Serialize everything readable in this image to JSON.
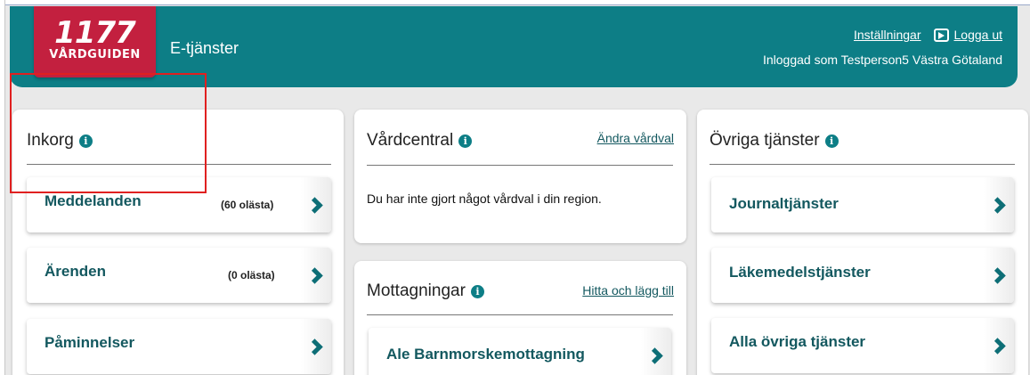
{
  "header": {
    "logo_number": "1177",
    "logo_text": "VÅRDGUIDEN",
    "app_title": "E-tjänster",
    "settings_link": "Inställningar",
    "logout_link": "Logga ut",
    "logged_in_text": "Inloggad som Testperson5 Västra Götaland"
  },
  "inbox": {
    "title": "Inkorg",
    "items": [
      {
        "label": "Meddelanden",
        "count": "(60 olästa)"
      },
      {
        "label": "Ärenden",
        "count": "(0 olästa)"
      },
      {
        "label": "Påminnelser",
        "count": ""
      }
    ]
  },
  "health_center": {
    "title": "Vårdcentral",
    "link": "Ändra vårdval",
    "message": "Du har inte gjort något vårdval i din region."
  },
  "clinics": {
    "title": "Mottagningar",
    "link": "Hitta och lägg till",
    "items": [
      {
        "label": "Ale Barnmorskemottagning"
      }
    ]
  },
  "other_services": {
    "title": "Övriga tjänster",
    "items": [
      {
        "label": "Journaltjänster"
      },
      {
        "label": "Läkemedelstjänster"
      },
      {
        "label": "Alla övriga tjänster"
      }
    ]
  },
  "colors": {
    "header_bg": "#0d7e86",
    "logo_bg": "#c3203f",
    "tile_text": "#13585f",
    "highlight": "#e02020"
  }
}
